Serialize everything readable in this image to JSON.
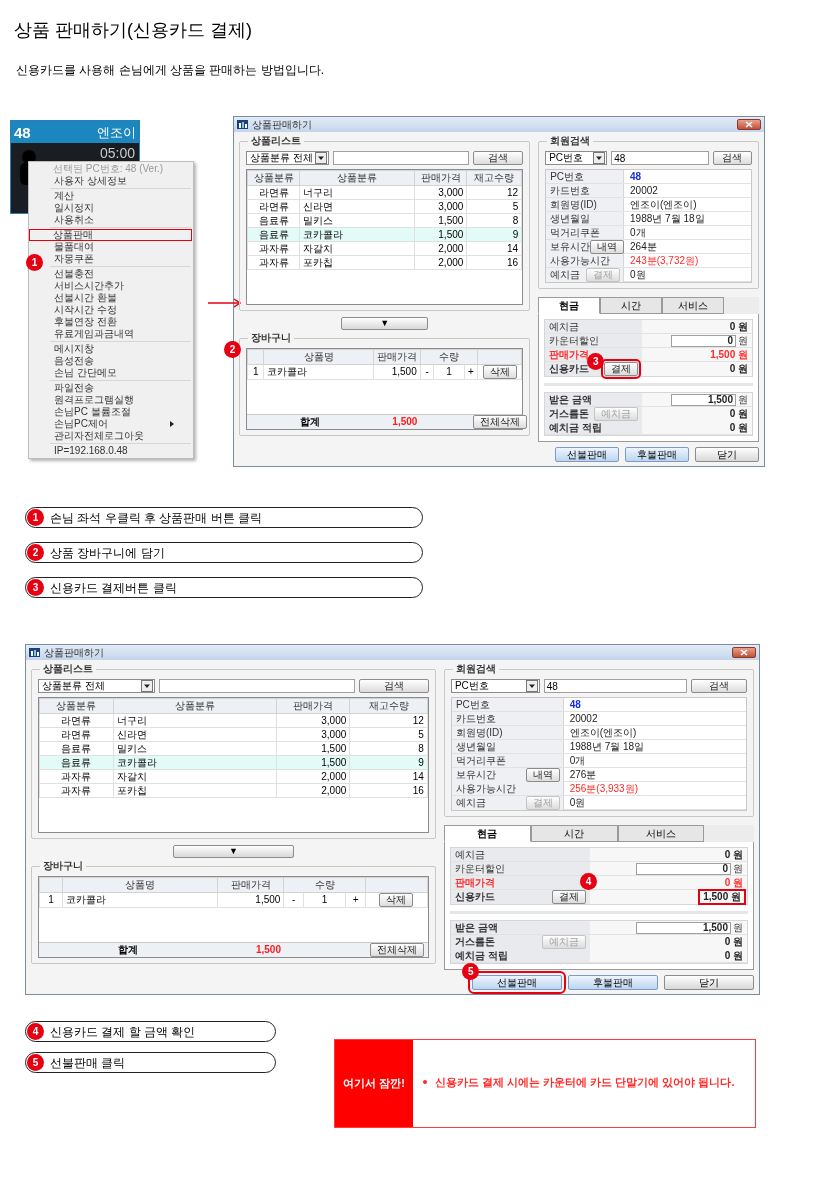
{
  "title": "상품 판매하기(신용카드 결제)",
  "subtitle": "신용카드를 사용해 손님에게 상품을 판매하는 방법입니다.",
  "seat_tile": {
    "number": "48",
    "name": "엔조이",
    "time": "05:00"
  },
  "context_menu": {
    "header": "선택된 PC번호: 48 (Ver.)",
    "badge": "1",
    "groups": [
      [
        {
          "label": "사용자 상세정보",
          "selected": false,
          "submenu": false
        }
      ],
      [
        {
          "label": "계산",
          "selected": false,
          "submenu": false
        },
        {
          "label": "일시정지",
          "selected": false,
          "submenu": false
        },
        {
          "label": "사용취소",
          "selected": false,
          "submenu": false
        }
      ],
      [
        {
          "label": "상품판매",
          "selected": true,
          "submenu": false
        },
        {
          "label": "물품대여",
          "selected": false,
          "submenu": false
        },
        {
          "label": "자몽쿠폰",
          "selected": false,
          "submenu": false
        }
      ],
      [
        {
          "label": "선불충전",
          "selected": false,
          "submenu": false
        },
        {
          "label": "서비스시간추가",
          "selected": false,
          "submenu": false
        },
        {
          "label": "선불시간 환불",
          "selected": false,
          "submenu": false
        },
        {
          "label": "시작시간 수정",
          "selected": false,
          "submenu": false
        },
        {
          "label": "후불연장 전환",
          "selected": false,
          "submenu": false
        },
        {
          "label": "유료게임과금내역",
          "selected": false,
          "submenu": false
        }
      ],
      [
        {
          "label": "메시지창",
          "selected": false,
          "submenu": false
        },
        {
          "label": "음성전송",
          "selected": false,
          "submenu": false
        },
        {
          "label": "손님 간단메모",
          "selected": false,
          "submenu": false
        }
      ],
      [
        {
          "label": "파일전송",
          "selected": false,
          "submenu": false
        },
        {
          "label": "원격프로그램실행",
          "selected": false,
          "submenu": false
        },
        {
          "label": "손님PC 볼륨조절",
          "selected": false,
          "submenu": false
        },
        {
          "label": "손님PC제어",
          "selected": false,
          "submenu": true
        },
        {
          "label": "관리자전체로그아웃",
          "selected": false,
          "submenu": false
        }
      ],
      [
        {
          "label": "IP=192.168.0.48",
          "selected": false,
          "submenu": false
        }
      ]
    ]
  },
  "windows": [
    {
      "title": "상품판매하기",
      "product_list": {
        "legend": "상품리스트",
        "category": "상품분류 전체",
        "search_button": "검색",
        "columns": [
          "상품분류",
          "상품분류",
          "판매가격",
          "재고수량"
        ],
        "rows": [
          {
            "cells": [
              "라면류",
              "너구리",
              "3,000",
              "12"
            ],
            "selected": false
          },
          {
            "cells": [
              "라면류",
              "신라면",
              "3,000",
              "5"
            ],
            "selected": false
          },
          {
            "cells": [
              "음료류",
              "밀키스",
              "1,500",
              "8"
            ],
            "selected": false
          },
          {
            "cells": [
              "음료류",
              "코카콜라",
              "1,500",
              "9"
            ],
            "selected": true
          },
          {
            "cells": [
              "과자류",
              "자갈치",
              "2,000",
              "14"
            ],
            "selected": false
          },
          {
            "cells": [
              "과자류",
              "포카칩",
              "2,000",
              "16"
            ],
            "selected": false
          }
        ]
      },
      "move_button": "▼",
      "cart": {
        "legend": "장바구니",
        "badge": "2",
        "columns": [
          "상품명",
          "판매가격",
          "수량"
        ],
        "rows": [
          {
            "no": "1",
            "name": "코카콜라",
            "price": "1,500",
            "minus": "-",
            "qty": "1",
            "plus": "+",
            "delete": "삭제"
          }
        ],
        "total_label": "합계",
        "total": "1,500",
        "clear_button": "전체삭제"
      },
      "member": {
        "legend": "회원검색",
        "field": "PC번호",
        "value": "48",
        "search_button": "검색",
        "rows": [
          {
            "label": "PC번호",
            "value": "48",
            "emphasized": true,
            "alert": false
          },
          {
            "label": "카드번호",
            "value": "20002",
            "emphasized": false,
            "alert": false
          },
          {
            "label": "회원명(ID)",
            "value": "엔조이(엔조이)",
            "emphasized": false,
            "alert": false
          },
          {
            "label": "생년월일",
            "value": "1988년 7월 18일",
            "emphasized": false,
            "alert": false
          },
          {
            "label": "먹거리쿠폰",
            "value": "0개",
            "emphasized": false,
            "alert": false
          },
          {
            "label": "보유시간",
            "button": "내역",
            "button_disabled": false,
            "value": "264분",
            "emphasized": false,
            "alert": false
          },
          {
            "label": "사용가능시간",
            "value": "243분(3,732원)",
            "emphasized": false,
            "alert": true
          },
          {
            "label": "예치금",
            "button": "결제",
            "button_disabled": true,
            "value": "0원",
            "emphasized": false,
            "alert": false
          }
        ]
      },
      "payment": {
        "tabs": [
          {
            "label": "현금",
            "selected": true
          },
          {
            "label": "시간",
            "selected": false
          },
          {
            "label": "서비스",
            "selected": false
          }
        ],
        "groups": [
          [
            {
              "label": "예치금",
              "label_red": false,
              "label_bold": false,
              "value": "0 원",
              "input": false,
              "value_red": false
            },
            {
              "label": "카운터할인",
              "label_red": false,
              "label_bold": false,
              "value": "0",
              "unit": "원",
              "input": true,
              "value_red": false
            },
            {
              "label": "판매가격",
              "label_red": true,
              "label_bold": true,
              "value": "1,500 원",
              "input": false,
              "value_red": true
            },
            {
              "label": "신용카드",
              "label_red": false,
              "label_bold": true,
              "button": "결제",
              "button_disabled": false,
              "value": "0 원",
              "input": false,
              "value_red": false,
              "callout": {
                "kind": "button",
                "badge": "3"
              }
            }
          ],
          [
            {
              "label": "받은 금액",
              "label_red": false,
              "label_bold": true,
              "value": "1,500",
              "unit": "원",
              "input": true,
              "value_red": false
            },
            {
              "label": "거스름돈",
              "label_red": false,
              "label_bold": true,
              "button": "예치금",
              "button_disabled": true,
              "value": "0 원",
              "input": false,
              "value_red": false
            },
            {
              "label": "예치금 적립",
              "label_red": false,
              "label_bold": true,
              "value": "0 원",
              "input": false,
              "value_red": false
            }
          ]
        ]
      },
      "buttons": [
        {
          "label": "선불판매",
          "kind": "sale"
        },
        {
          "label": "후불판매",
          "kind": "sale"
        },
        {
          "label": "닫기",
          "kind": "close"
        }
      ]
    },
    {
      "title": "상품판매하기",
      "product_list": {
        "legend": "상품리스트",
        "category": "상품분류 전체",
        "search_button": "검색",
        "columns": [
          "상품분류",
          "상품분류",
          "판매가격",
          "재고수량"
        ],
        "rows": [
          {
            "cells": [
              "라면류",
              "너구리",
              "3,000",
              "12"
            ],
            "selected": false
          },
          {
            "cells": [
              "라면류",
              "신라면",
              "3,000",
              "5"
            ],
            "selected": false
          },
          {
            "cells": [
              "음료류",
              "밀키스",
              "1,500",
              "8"
            ],
            "selected": false
          },
          {
            "cells": [
              "음료류",
              "코카콜라",
              "1,500",
              "9"
            ],
            "selected": true
          },
          {
            "cells": [
              "과자류",
              "자갈치",
              "2,000",
              "14"
            ],
            "selected": false
          },
          {
            "cells": [
              "과자류",
              "포카칩",
              "2,000",
              "16"
            ],
            "selected": false
          }
        ]
      },
      "move_button": "▼",
      "cart": {
        "legend": "장바구니",
        "columns": [
          "상품명",
          "판매가격",
          "수량"
        ],
        "rows": [
          {
            "no": "1",
            "name": "코카콜라",
            "price": "1,500",
            "minus": "-",
            "qty": "1",
            "plus": "+",
            "delete": "삭제"
          }
        ],
        "total_label": "합계",
        "total": "1,500",
        "clear_button": "전체삭제"
      },
      "member": {
        "legend": "회원검색",
        "field": "PC번호",
        "value": "48",
        "search_button": "검색",
        "rows": [
          {
            "label": "PC번호",
            "value": "48",
            "emphasized": true,
            "alert": false
          },
          {
            "label": "카드번호",
            "value": "20002",
            "emphasized": false,
            "alert": false
          },
          {
            "label": "회원명(ID)",
            "value": "엔조이(엔조이)",
            "emphasized": false,
            "alert": false
          },
          {
            "label": "생년월일",
            "value": "1988년 7월 18일",
            "emphasized": false,
            "alert": false
          },
          {
            "label": "먹거리쿠폰",
            "value": "0개",
            "emphasized": false,
            "alert": false
          },
          {
            "label": "보유시간",
            "button": "내역",
            "button_disabled": false,
            "value": "276분",
            "emphasized": false,
            "alert": false
          },
          {
            "label": "사용가능시간",
            "value": "256분(3,933원)",
            "emphasized": false,
            "alert": true
          },
          {
            "label": "예치금",
            "button": "결제",
            "button_disabled": true,
            "value": "0원",
            "emphasized": false,
            "alert": false
          }
        ]
      },
      "payment": {
        "tabs": [
          {
            "label": "현금",
            "selected": true
          },
          {
            "label": "시간",
            "selected": false
          },
          {
            "label": "서비스",
            "selected": false
          }
        ],
        "groups": [
          [
            {
              "label": "예치금",
              "label_red": false,
              "label_bold": false,
              "value": "0 원",
              "input": false,
              "value_red": false
            },
            {
              "label": "카운터할인",
              "label_red": false,
              "label_bold": false,
              "value": "0",
              "unit": "원",
              "input": true,
              "value_red": false
            },
            {
              "label": "판매가격",
              "label_red": true,
              "label_bold": true,
              "value": "0 원",
              "input": false,
              "value_red": true
            },
            {
              "label": "신용카드",
              "label_red": false,
              "label_bold": true,
              "button": "결제",
              "button_disabled": false,
              "value": "1,500 원",
              "input": false,
              "value_red": false,
              "callout": {
                "kind": "value",
                "badge": "4"
              }
            }
          ],
          [
            {
              "label": "받은 금액",
              "label_red": false,
              "label_bold": true,
              "value": "1,500",
              "unit": "원",
              "input": true,
              "value_red": false
            },
            {
              "label": "거스름돈",
              "label_red": false,
              "label_bold": true,
              "button": "예치금",
              "button_disabled": true,
              "value": "0 원",
              "input": false,
              "value_red": false
            },
            {
              "label": "예치금 적립",
              "label_red": false,
              "label_bold": true,
              "value": "0 원",
              "input": false,
              "value_red": false
            }
          ]
        ]
      },
      "buttons": [
        {
          "label": "선불판매",
          "kind": "sale",
          "callout": {
            "kind": "button",
            "badge": "5"
          }
        },
        {
          "label": "후불판매",
          "kind": "sale"
        },
        {
          "label": "닫기",
          "kind": "close"
        }
      ]
    }
  ],
  "steps_top": [
    {
      "number": "1",
      "text": "손님 좌석 우클릭 후 상품판매 버튼 클릭"
    },
    {
      "number": "2",
      "text": "상품 장바구니에 담기"
    },
    {
      "number": "3",
      "text": "신용카드 결제버튼 클릭"
    }
  ],
  "steps_bottom": [
    {
      "number": "4",
      "text": "신용카드 결제 할 금액 확인"
    },
    {
      "number": "5",
      "text": "선불판매 클릭"
    }
  ],
  "note": {
    "label": "여기서 잠깐!",
    "items": [
      "신용카드 결제 시에는 카운터에 카드 단말기에 있어야 됩니다."
    ]
  }
}
